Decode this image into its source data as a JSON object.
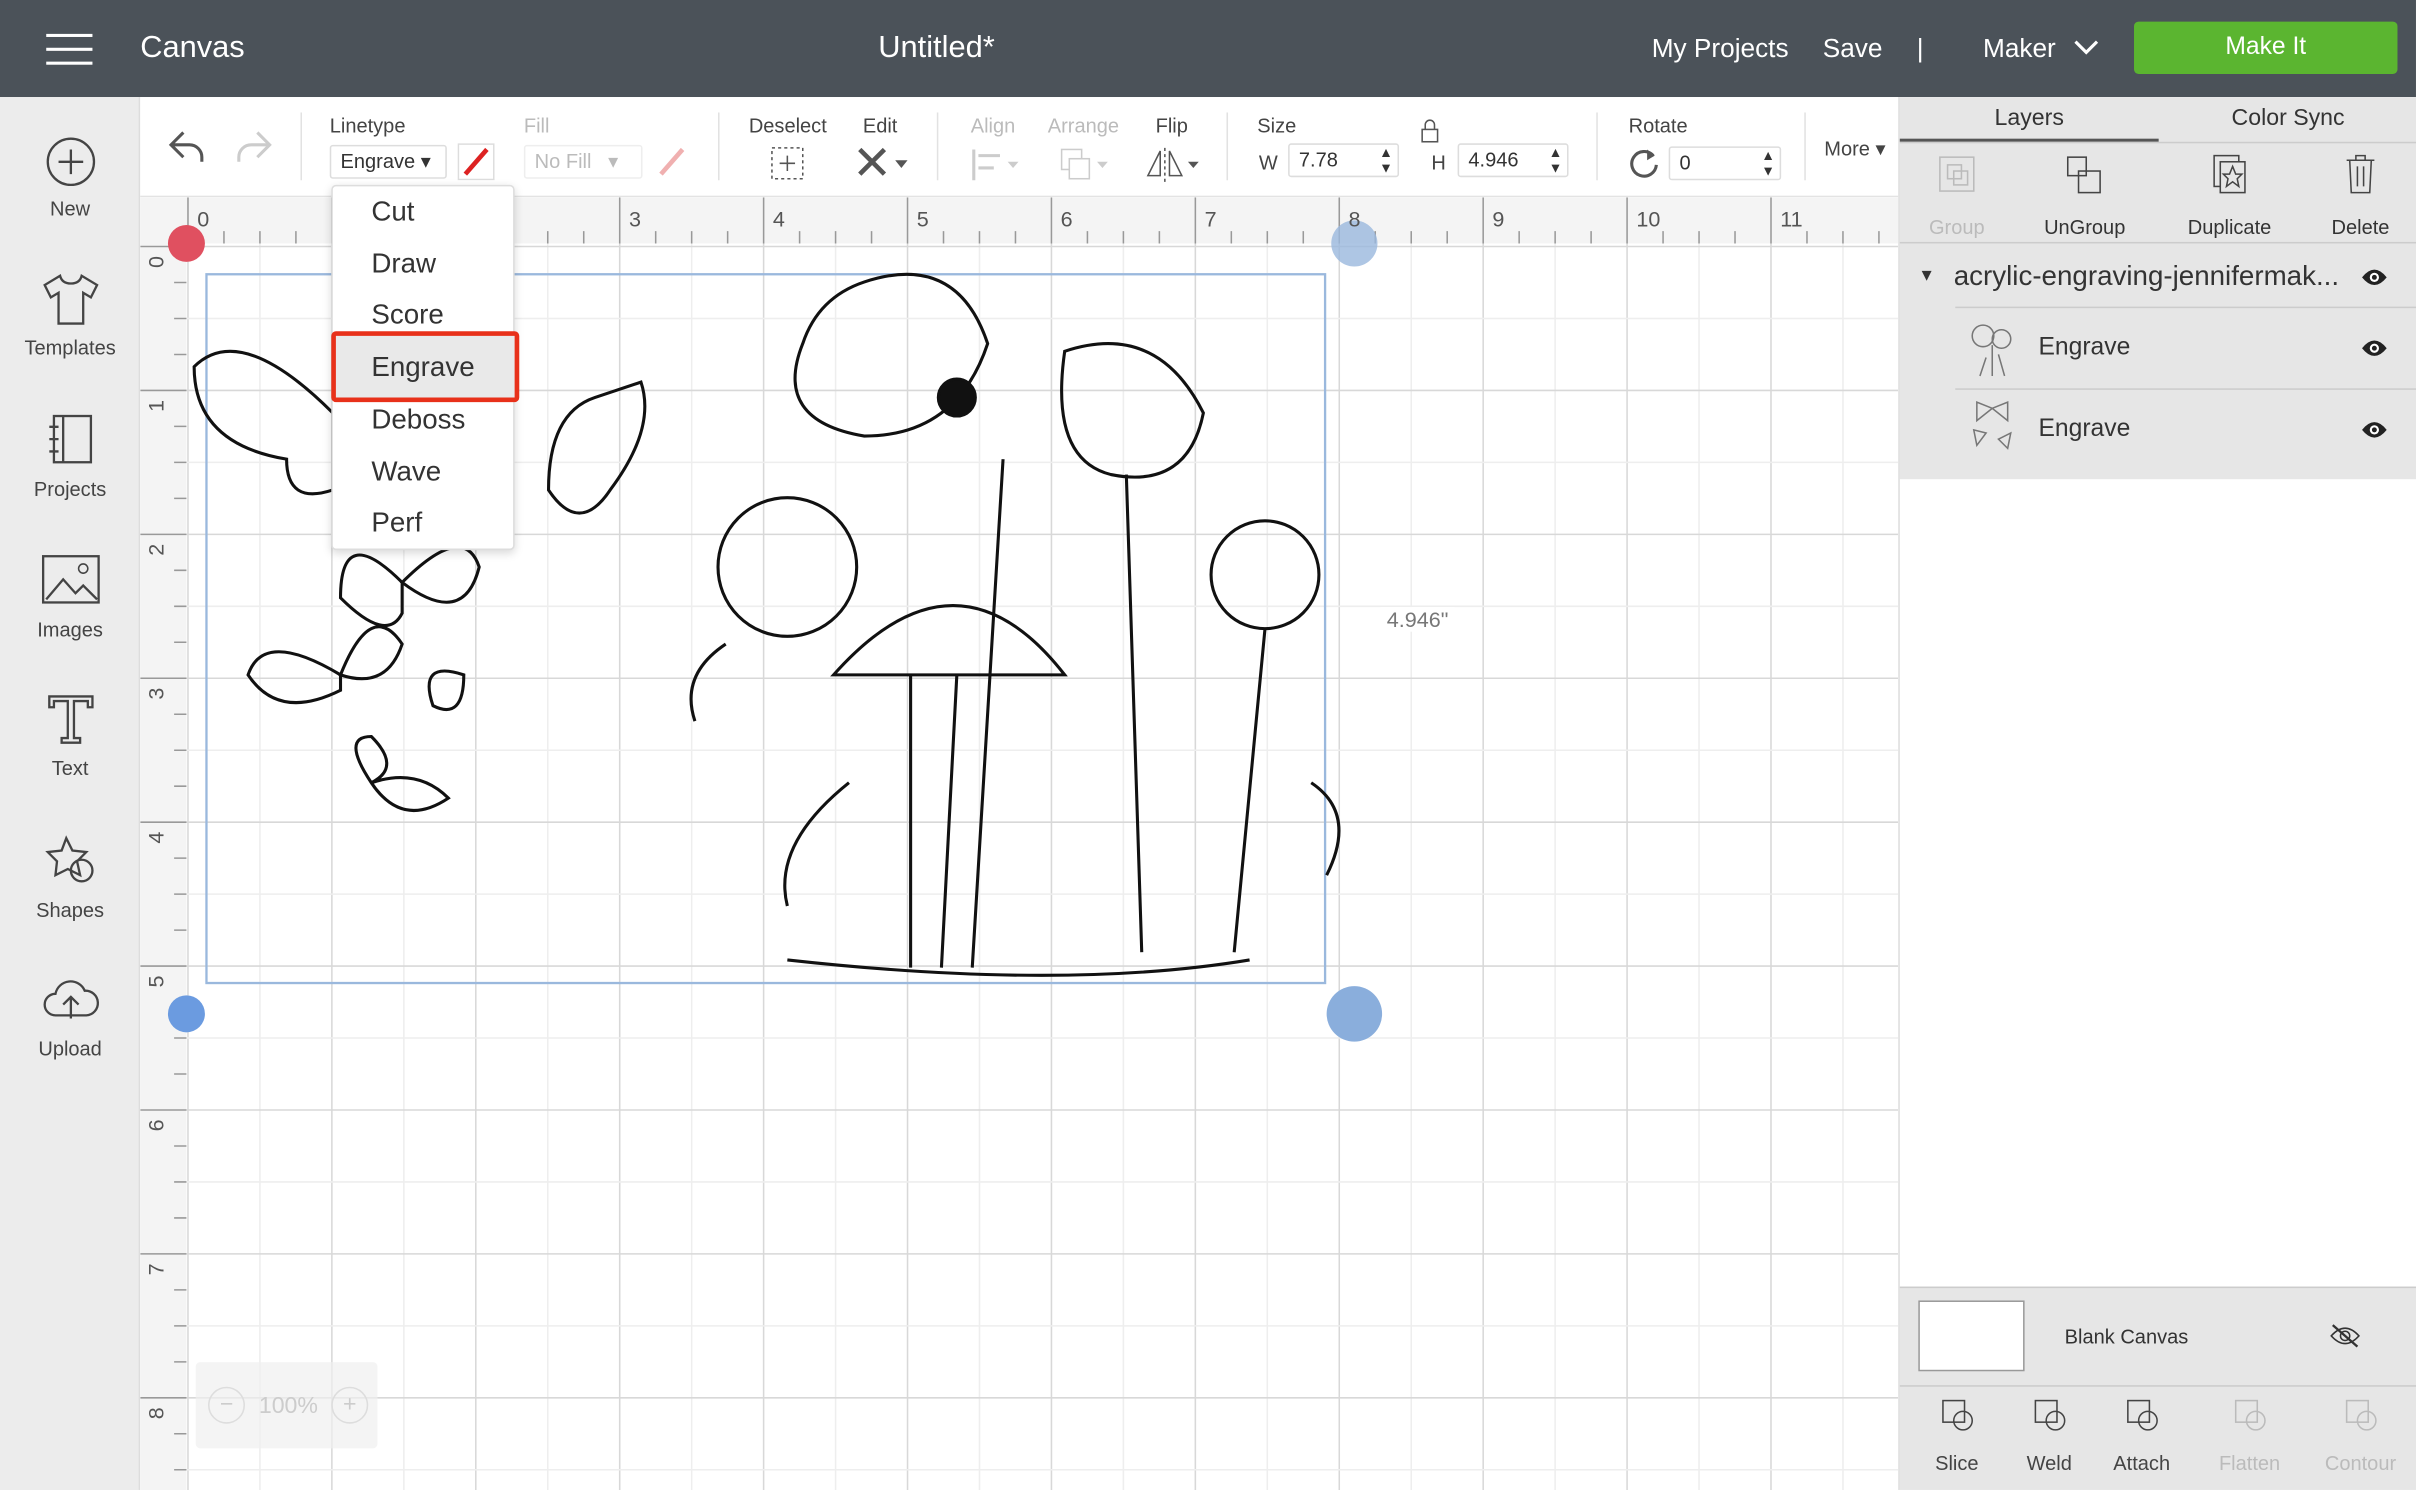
{
  "topbar": {
    "app_title": "Canvas",
    "doc_title": "Untitled*",
    "my_projects": "My Projects",
    "save": "Save",
    "divider": "|",
    "machine": "Maker",
    "make_it": "Make It",
    "make_it_color": "#5bb530"
  },
  "leftnav": [
    {
      "label": "New",
      "icon": "plus-circle-icon"
    },
    {
      "label": "Templates",
      "icon": "tshirt-icon"
    },
    {
      "label": "Projects",
      "icon": "book-icon"
    },
    {
      "label": "Images",
      "icon": "image-icon"
    },
    {
      "label": "Text",
      "icon": "text-icon"
    },
    {
      "label": "Shapes",
      "icon": "shapes-icon"
    },
    {
      "label": "Upload",
      "icon": "cloud-upload-icon"
    }
  ],
  "toolbar": {
    "linetype_label": "Linetype",
    "linetype_value": "Engrave",
    "fill_label": "Fill",
    "fill_value": "No Fill",
    "deselect": "Deselect",
    "edit": "Edit",
    "align": "Align",
    "arrange": "Arrange",
    "flip": "Flip",
    "size": "Size",
    "w_label": "W",
    "w_value": "7.78",
    "h_label": "H",
    "h_value": "4.946",
    "rotate": "Rotate",
    "rotate_value": "0",
    "more": "More"
  },
  "linetype_menu": {
    "options": [
      "Cut",
      "Draw",
      "Score",
      "Engrave",
      "Deboss",
      "Wave",
      "Perf"
    ],
    "selected": "Engrave",
    "highlight_color": "#e8311a"
  },
  "canvas": {
    "ruler_x": [
      "0",
      "1",
      "2",
      "3",
      "4",
      "5",
      "6",
      "7",
      "8",
      "9",
      "10",
      "11"
    ],
    "ruler_y": [
      "0",
      "1",
      "2",
      "3",
      "4",
      "5",
      "6",
      "7",
      "8"
    ],
    "height_readout": "4.946\"",
    "zoom": "100%"
  },
  "panel": {
    "tabs": [
      "Layers",
      "Color Sync"
    ],
    "actions": [
      {
        "label": "Group",
        "enabled": false
      },
      {
        "label": "UnGroup",
        "enabled": true
      },
      {
        "label": "Duplicate",
        "enabled": true
      },
      {
        "label": "Delete",
        "enabled": true
      }
    ],
    "group_name": "acrylic-engraving-jennifermak...",
    "layers": [
      {
        "name": "Engrave"
      },
      {
        "name": "Engrave"
      }
    ],
    "blank_canvas": "Blank Canvas",
    "bottom_actions": [
      {
        "label": "Slice",
        "enabled": true
      },
      {
        "label": "Weld",
        "enabled": true
      },
      {
        "label": "Attach",
        "enabled": true
      },
      {
        "label": "Flatten",
        "enabled": false
      },
      {
        "label": "Contour",
        "enabled": false
      }
    ]
  }
}
